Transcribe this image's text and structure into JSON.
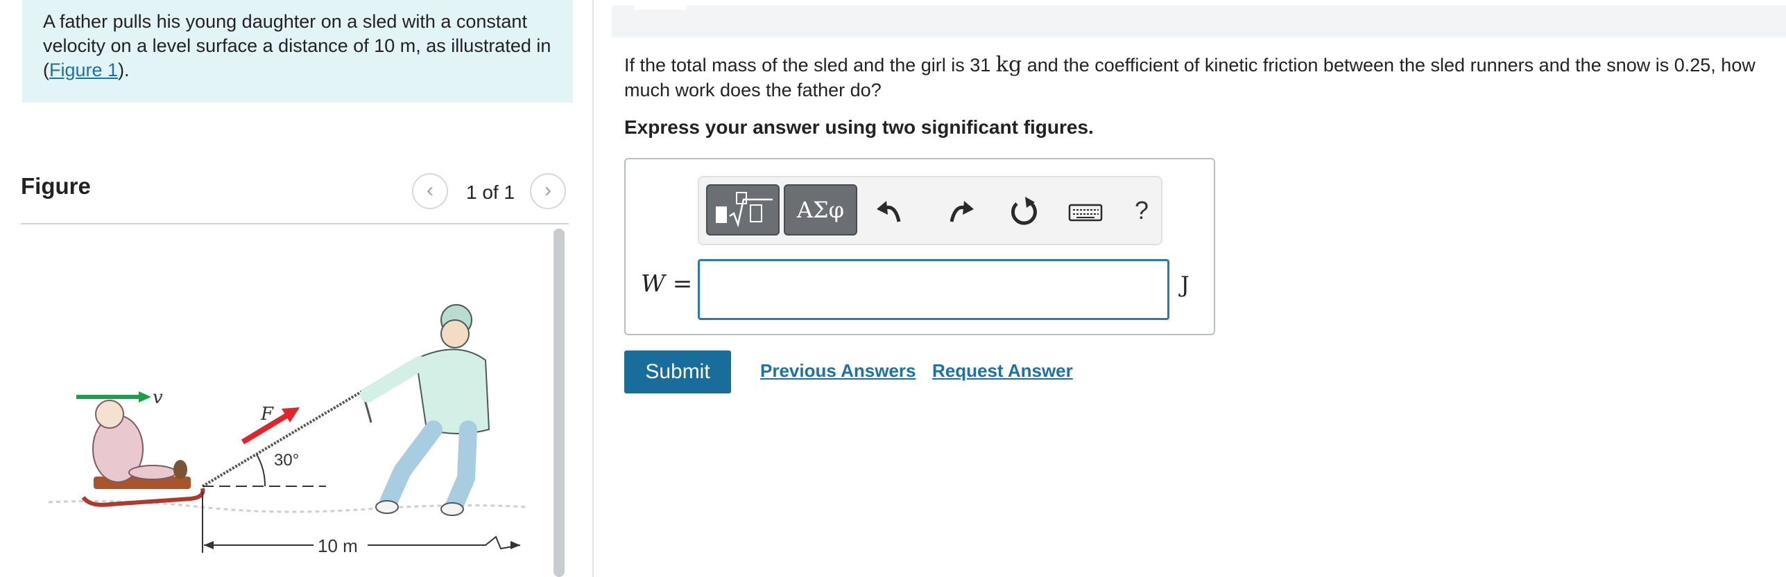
{
  "intro": {
    "text_before_link": "A father pulls his young daughter on a sled with a constant velocity on a level surface a distance of 10 m, as illustrated in (",
    "link": "Figure 1",
    "text_after_link": ")."
  },
  "figure": {
    "title": "Figure",
    "pager": "1 of 1",
    "label_v": "v",
    "label_F": "F",
    "label_angle": "30°",
    "label_distance": "10 m"
  },
  "question": {
    "part1": "If the total mass of the sled and the girl is 31 ",
    "unit": "kg",
    "part2": " and the coefficient of kinetic friction between the sled runners and the snow is 0.25, how much work does the father do?",
    "instruction": "Express your answer using two significant figures."
  },
  "answer": {
    "variable": "W",
    "equals": "=",
    "value": "",
    "unit": "J",
    "toolbar": {
      "greek_label": "ΑΣφ",
      "help_label": "?"
    }
  },
  "actions": {
    "submit": "Submit",
    "previous_answers": "Previous Answers",
    "request_answer": "Request Answer"
  },
  "colors": {
    "accent": "#186d9a",
    "link": "#1a73a8",
    "intro_bg": "#e3f4f6",
    "velocity_arrow": "#1e9e4a",
    "force_arrow": "#e2232a"
  }
}
